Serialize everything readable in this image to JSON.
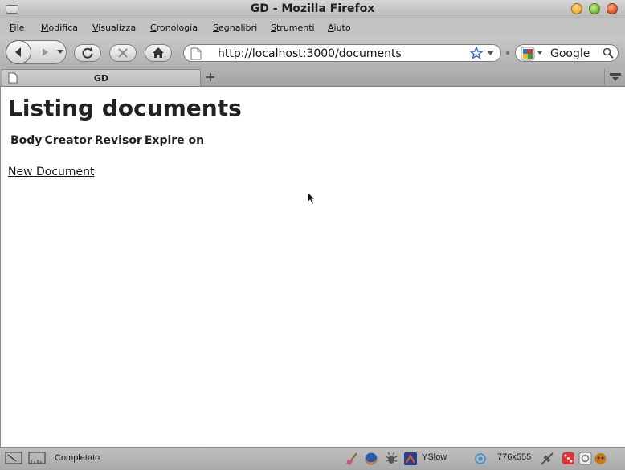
{
  "window": {
    "title": "GD - Mozilla Firefox"
  },
  "menu": {
    "items": [
      {
        "underline": "F",
        "rest": "ile"
      },
      {
        "underline": "M",
        "rest": "odifica"
      },
      {
        "underline": "V",
        "rest": "isualizza"
      },
      {
        "underline": "C",
        "rest": "ronologia"
      },
      {
        "underline": "S",
        "rest": "egnalibri"
      },
      {
        "underline": "S",
        "rest": "trumenti"
      },
      {
        "underline": "A",
        "rest": "iuto"
      }
    ]
  },
  "toolbar": {
    "url": "http://localhost:3000/documents",
    "search_placeholder": "Google"
  },
  "tabs": [
    {
      "label": "GD"
    }
  ],
  "page": {
    "heading": "Listing documents",
    "table_headers": [
      "Body",
      "Creator",
      "Revisor",
      "Expire on"
    ],
    "new_link": "New Document"
  },
  "status": {
    "text": "Completato",
    "yslow": "YSlow",
    "dimensions": "776x555"
  },
  "colors": {
    "close": "#e2572a",
    "minimize": "#f0b43a",
    "maximize": "#7cbf3c"
  }
}
